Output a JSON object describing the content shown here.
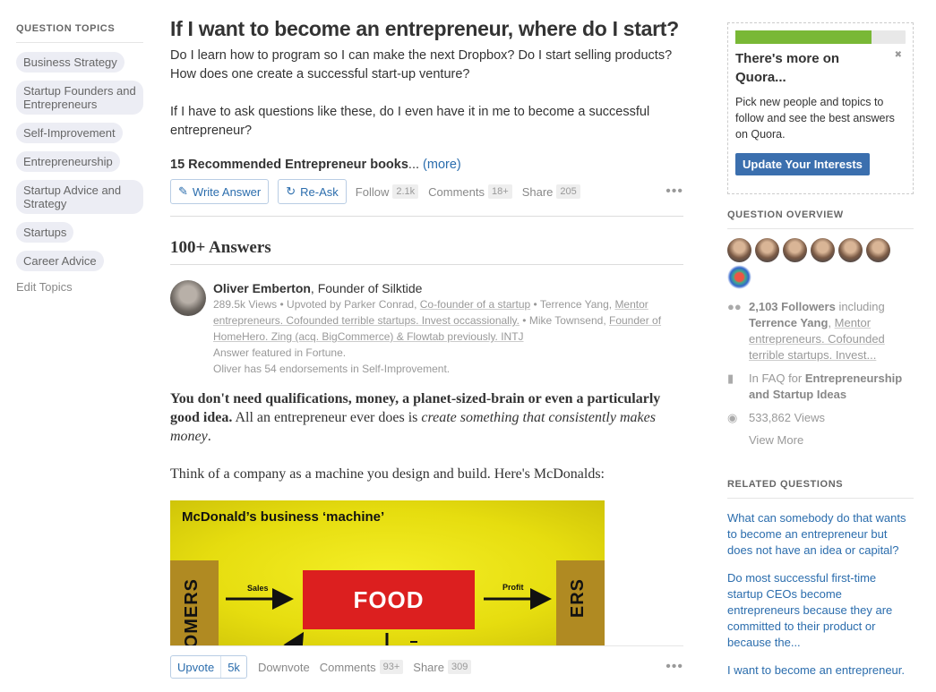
{
  "left": {
    "header": "QUESTION TOPICS",
    "topics": [
      "Business Strategy",
      "Startup Founders and Entrepreneurs",
      "Self-Improvement",
      "Entrepreneurship",
      "Startup Advice and Strategy",
      "Startups",
      "Career Advice"
    ],
    "edit_topics": "Edit Topics"
  },
  "question": {
    "title": "If I want to become an entrepreneur, where do I start?",
    "detail_1": "Do I learn how to program so I can make the next Dropbox? Do I start selling products? How does one create a successful start-up venture?",
    "detail_2": "If I have to ask questions like these, do I even have it in me to become a successful entrepreneur?",
    "books": "15 Recommended Entrepreneur books",
    "ellipsis": "...",
    "more": "(more)",
    "write_answer": "Write Answer",
    "re_ask": "Re-Ask",
    "follow": "Follow",
    "follow_count": "2.1k",
    "comments": "Comments",
    "comments_count": "18+",
    "share": "Share",
    "share_count": "205",
    "more_menu": "•••"
  },
  "answers": {
    "header": "100+ Answers",
    "author_name": "Oliver Emberton",
    "author_cred": ", Founder of Silktide",
    "views": "289.5k Views • Upvoted by Parker Conrad, ",
    "upvoter1_cred": "Co-founder of a startup",
    "sep1": " • Terrence Yang, ",
    "upvoter2_cred": "Mentor entrepreneurs. Cofounded terrible startups. Invest occassionally.",
    "sep2": " • Mike Townsend, ",
    "upvoter3_cred": "Founder of HomeHero. Zing (acq. BigCommerce) & Flowtab previously. INTJ",
    "featured": "Answer featured in Fortune.",
    "endorsements": "Oliver has 54 endorsements in Self-Improvement.",
    "body_bold": "You don't need qualifications, money, a planet-sized-brain or even a particularly good idea.",
    "body_normal": " All an entrepreneur ever does is ",
    "body_italic": "create something that consistently makes money",
    "body_end": ".",
    "body_2": "Think of a company as a machine you design and build. Here's McDonalds:",
    "diagram": {
      "title": "McDonald’s business ‘machine’",
      "left_box": "OMERS",
      "right_box": "ERS",
      "center_box": "FOOD",
      "label_sales": "Sales",
      "label_profit": "Profit"
    },
    "upvote": "Upvote",
    "upvote_count": "5k",
    "downvote": "Downvote",
    "comments": "Comments",
    "comments_count": "93+",
    "share": "Share",
    "share_count": "309",
    "more_menu": "•••"
  },
  "right": {
    "promo_progress": 0.8,
    "promo_title": "There's more on Quora...",
    "promo_close": "✖",
    "promo_text": "Pick new people and topics to follow and see the best answers on Quora.",
    "promo_button": "Update Your Interests",
    "overview_header": "QUESTION OVERVIEW",
    "followers_bold": "2,103 Followers",
    "followers_text": " including ",
    "follower_name": "Terrence Yang",
    "follower_sep": ", ",
    "follower_cred": "Mentor entrepreneurs. Cofounded terrible startups. Invest...",
    "faq_text": "In FAQ for ",
    "faq_bold": "Entrepreneurship and Startup Ideas",
    "views": "533,862 Views",
    "view_more": "View More",
    "related_header": "RELATED QUESTIONS",
    "related": [
      "What can somebody do that wants to become an entrepreneur but does not have an idea or capital?",
      "Do most successful first-time startup CEOs become entrepreneurs because they are committed to their product or because the...",
      "I want to become an entrepreneur."
    ]
  },
  "colors": {
    "link": "#2b6dad",
    "progress": "#79b836",
    "primary_button": "#3b6fae",
    "diagram_yellow": "#ebe21a",
    "diagram_red": "#dc1f1f"
  }
}
